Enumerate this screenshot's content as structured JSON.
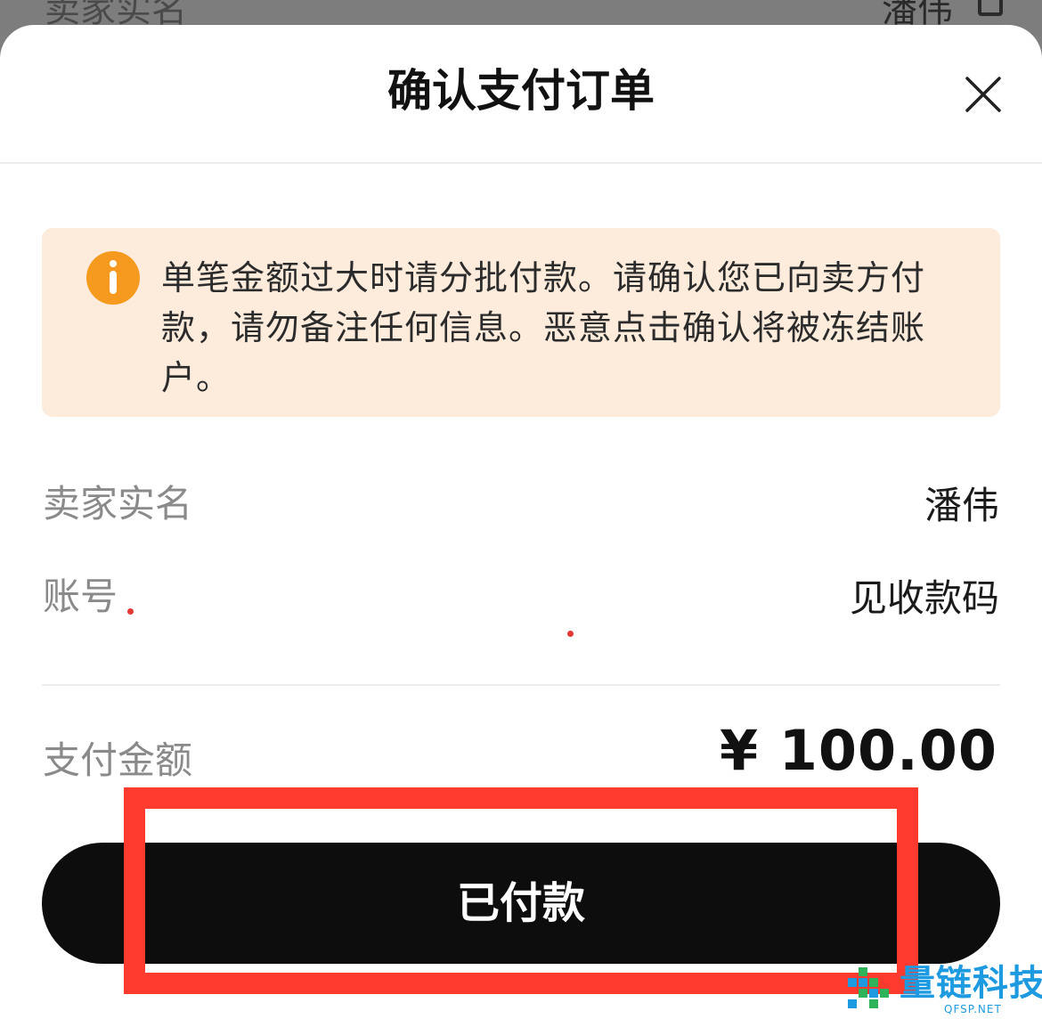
{
  "background": {
    "left_text": "卖家实名",
    "right_text": "潘伟"
  },
  "sheet": {
    "title": "确认支付订单"
  },
  "notice": {
    "text": "单笔金额过大时请分批付款。请确认您已向卖方付款，请勿备注任何信息。恶意点击确认将被冻结账户。"
  },
  "rows": [
    {
      "label": "卖家实名",
      "value": "潘伟"
    },
    {
      "label": "账号",
      "value": "见收款码"
    }
  ],
  "payment": {
    "label": "支付金额",
    "amount": "¥ 100.00"
  },
  "button": {
    "label": "已付款"
  },
  "watermark": {
    "brand": "量链科技",
    "domain": "QFSP.NET"
  },
  "colors": {
    "notice_bg": "#fdebdc",
    "notice_icon": "#f59a1f",
    "button_bg": "#0d0d0d",
    "highlight": "#ff3b30",
    "watermark": "#1e9be0"
  },
  "icons": {
    "close": "close-icon",
    "notice": "info-icon",
    "copy": "copy-icon"
  }
}
